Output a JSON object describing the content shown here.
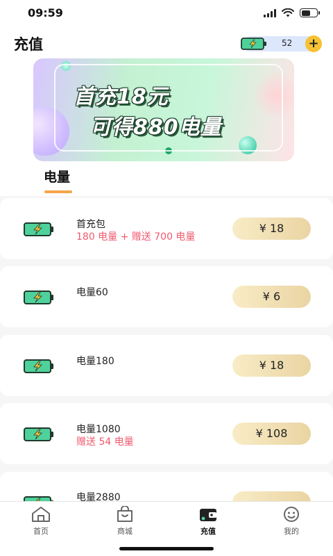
{
  "status_bar": {
    "time": "09:59"
  },
  "header": {
    "title": "充值",
    "balance": "52",
    "add_label": "+"
  },
  "banner": {
    "line1": "首充18元",
    "line2": "可得880电量"
  },
  "tabs": {
    "active": "电量"
  },
  "products": [
    {
      "name": "首充包",
      "bonus": "180 电量 + 赠送 700 电量",
      "price": "¥ 18"
    },
    {
      "name": "电量60",
      "bonus": "",
      "price": "¥ 6"
    },
    {
      "name": "电量180",
      "bonus": "",
      "price": "¥ 18"
    },
    {
      "name": "电量1080",
      "bonus": "赠送 54 电量",
      "price": "¥ 108"
    },
    {
      "name": "电量2880",
      "bonus": "",
      "price": ""
    }
  ],
  "bottom_nav": [
    {
      "label": "首页",
      "icon": "home-icon"
    },
    {
      "label": "商城",
      "icon": "shopping-bag-icon"
    },
    {
      "label": "充值",
      "icon": "wallet-icon",
      "active": true
    },
    {
      "label": "我的",
      "icon": "profile-icon"
    }
  ],
  "colors": {
    "accent": "#f5a44a",
    "bonus_text": "#ef5a6e",
    "add_button": "#f6c233",
    "battery_green": "#4fd19c"
  }
}
